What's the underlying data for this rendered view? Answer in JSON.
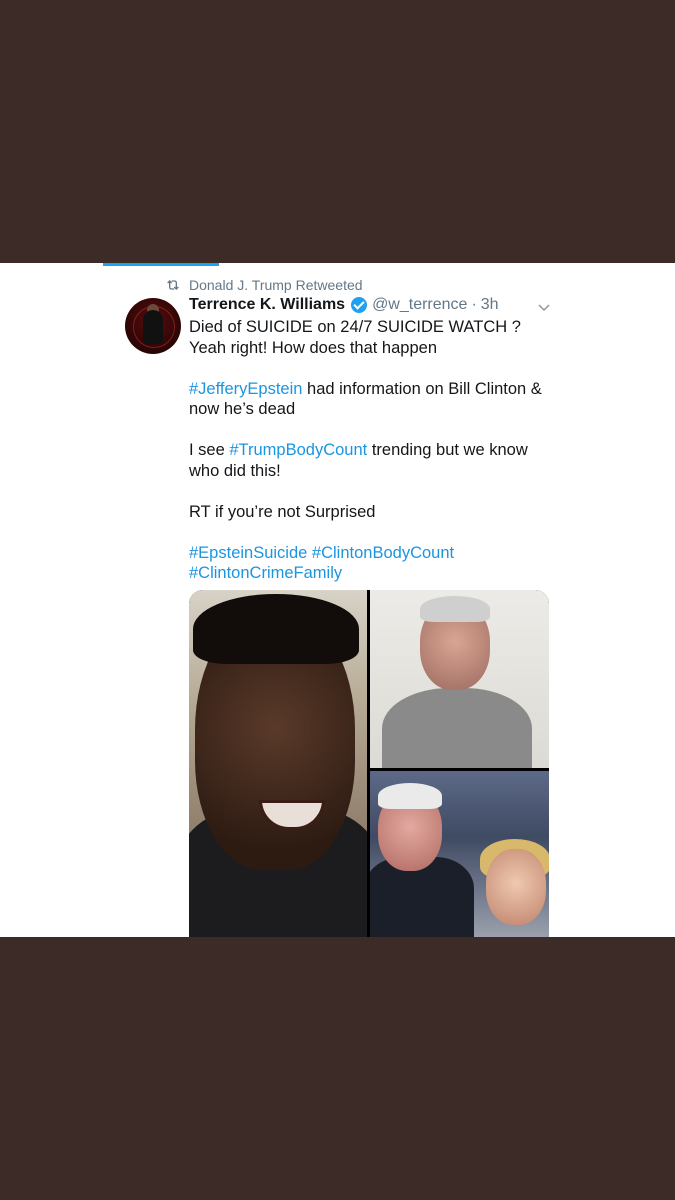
{
  "retweet": {
    "label": "Donald J. Trump Retweeted"
  },
  "author": {
    "name": "Terrence K. Williams",
    "handle": "@w_terrence",
    "time": "3h"
  },
  "tweet": {
    "line1": "Died of SUICIDE on 24/7 SUICIDE WATCH ? Yeah right! How does that happen",
    "hashtag_epstein": "#JefferyEpstein",
    "line2": " had information on Bill Clinton & now he’s dead",
    "line3_pre": "I see ",
    "hashtag_trump": "#TrumpBodyCount",
    "line3_post": " trending but we know who did this!",
    "line4": "RT if you’re not Surprised",
    "hashtag_suicide": "#EpsteinSuicide",
    "hashtag_clinton_count": "#ClintonBodyCount",
    "hashtag_crime_family": "#ClintonCrimeFamily"
  },
  "icons": {
    "retweet": "retweet-icon",
    "verified": "verified-badge-icon",
    "more": "chevron-down-icon"
  },
  "colors": {
    "background": "#3d2b28",
    "link": "#1b95e0",
    "accent": "#1da1f2",
    "muted": "#657786"
  }
}
